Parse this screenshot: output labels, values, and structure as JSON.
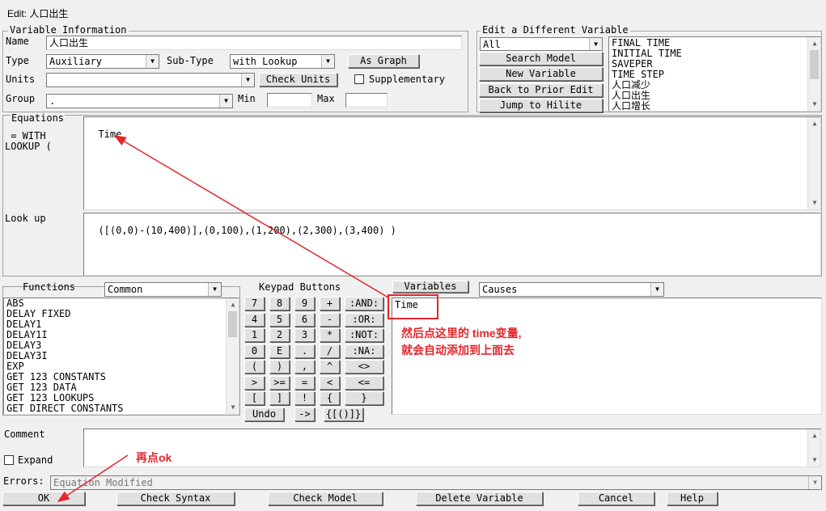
{
  "window": {
    "title": "Edit: 人口出生"
  },
  "variable_info": {
    "group_label": "Variable Information",
    "name_label": "Name",
    "name_value": "人口出生",
    "type_label": "Type",
    "type_value": "Auxiliary",
    "subtype_label": "Sub-Type",
    "subtype_value": "with Lookup",
    "as_graph_label": "As Graph",
    "units_label": "Units",
    "units_value": "",
    "check_units_label": "Check Units",
    "supplementary_label": "Supplementary",
    "group_field_label": "Group",
    "group_value": ".",
    "min_label": "Min",
    "min_value": "",
    "max_label": "Max",
    "max_value": ""
  },
  "edit_different": {
    "group_label": "Edit a Different Variable",
    "filter_value": "All",
    "search_model_label": "Search Model",
    "new_variable_label": "New Variable",
    "back_prior_label": "Back to Prior Edit",
    "jump_hilite_label": "Jump to Hilite",
    "variables": [
      "FINAL TIME",
      "INITIAL TIME",
      "SAVEPER",
      "TIME STEP",
      "人口减少",
      "人口出生",
      "人口增长"
    ]
  },
  "equations": {
    "label": "Equations",
    "prefix": " = WITH\nLOOKUP (",
    "value": "Time",
    "lookup_label": "Look up",
    "lookup_value": "([(0,0)-(10,400)],(0,100),(1,200),(2,300),(3,400) )"
  },
  "functions": {
    "label": "Functions",
    "category_value": "Common",
    "items": [
      "ABS",
      "DELAY FIXED",
      "DELAY1",
      "DELAY1I",
      "DELAY3",
      "DELAY3I",
      "EXP",
      "GET 123 CONSTANTS",
      "GET 123 DATA",
      "GET 123 LOOKUPS",
      "GET DIRECT CONSTANTS"
    ]
  },
  "keypad": {
    "label": "Keypad Buttons",
    "rows": [
      [
        "7",
        "8",
        "9",
        "+",
        ":AND:"
      ],
      [
        "4",
        "5",
        "6",
        "-",
        ":OR:"
      ],
      [
        "1",
        "2",
        "3",
        "*",
        ":NOT:"
      ],
      [
        "0",
        "E",
        ".",
        "/",
        ":NA:"
      ],
      [
        "(",
        ")",
        ",",
        "^",
        "<>"
      ],
      [
        ">",
        ">=",
        "=",
        "<",
        "<="
      ],
      [
        "[",
        "]",
        "!",
        "{",
        "}"
      ]
    ],
    "undo_label": "Undo",
    "arrow_label": "->",
    "brackets_label": "{[()]}"
  },
  "variables_panel": {
    "button_label": "Variables",
    "mode_value": "Causes",
    "items": [
      "Time"
    ]
  },
  "comment": {
    "label": "Comment",
    "value": "",
    "expand_label": "Expand"
  },
  "errors": {
    "label": "Errors:",
    "value": "Equation Modified"
  },
  "bottom_buttons": {
    "ok": "OK",
    "check_syntax": "Check Syntax",
    "check_model": "Check Model",
    "delete_variable": "Delete Variable",
    "cancel": "Cancel",
    "help": "Help"
  },
  "annotations": {
    "note1_line1": "然后点这里的 time变量,",
    "note1_line2": "就会自动添加到上面去",
    "note2": "再点ok",
    "color": "#e4262d"
  }
}
